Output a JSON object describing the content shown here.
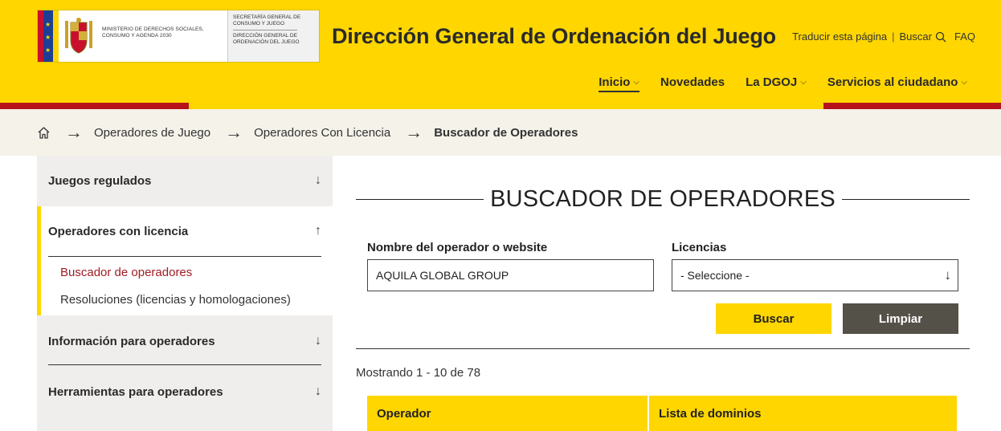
{
  "header": {
    "ministry_text": "Ministerio de Derechos Sociales, Consumo y Agenda 2030",
    "secretaria_text": "Secretaría General de Consumo y Juego",
    "direccion_text": "Dirección General de Ordenación del Juego",
    "site_title": "Dirección General de Ordenación del Juego",
    "top_links": {
      "translate": "Traducir esta página",
      "search": "Buscar",
      "faq": "FAQ"
    },
    "nav": [
      {
        "label": "Inicio"
      },
      {
        "label": "Novedades"
      },
      {
        "label": "La DGOJ"
      },
      {
        "label": "Servicios al ciudadano"
      }
    ]
  },
  "breadcrumb": {
    "items": [
      "Operadores de Juego",
      "Operadores Con Licencia",
      "Buscador de Operadores"
    ]
  },
  "sidebar": {
    "sections": [
      {
        "label": "Juegos regulados"
      },
      {
        "label": "Operadores con licencia"
      },
      {
        "label": "Información para operadores"
      },
      {
        "label": "Herramientas para operadores"
      }
    ],
    "sub_items": [
      {
        "label": "Buscador de operadores"
      },
      {
        "label": "Resoluciones (licencias y homologaciones)"
      }
    ]
  },
  "main": {
    "title": "BUSCADOR DE OPERADORES",
    "operator_label": "Nombre del operador o website",
    "operator_value": "AQUILA GLOBAL GROUP",
    "licencias_label": "Licencias",
    "licencias_selected": "- Seleccione -",
    "search_button": "Buscar",
    "clear_button": "Limpiar",
    "results_count": "Mostrando 1 - 10 de 78",
    "table_headers": [
      "Operador",
      "Lista de dominios"
    ]
  },
  "colors": {
    "brand_yellow": "#ffd600",
    "brand_red": "#b5121b",
    "active_link": "#a01c22",
    "clear_button_bg": "#545148"
  }
}
